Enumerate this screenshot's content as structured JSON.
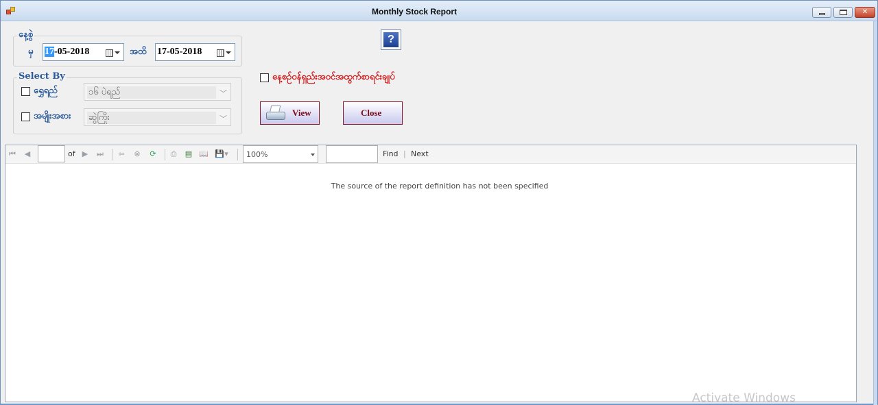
{
  "window": {
    "title": "Monthly Stock Report"
  },
  "date_group": {
    "legend": "နေ့စွဲ",
    "from_label": "မှ",
    "from_value_selected": "17",
    "from_value_rest": "-05-2018",
    "to_label": "အထိ",
    "to_value": "17-05-2018"
  },
  "select_by": {
    "legend": "Select By",
    "row1_label": "ရွှေရည်",
    "row1_value": "၁၆ ပဲရည်",
    "row2_label": "အမျိုးအစား",
    "row2_value": "ဆွဲကြိုး"
  },
  "options": {
    "daily_checkbox_label": "နေ့စဉ်ဝန်ရှည်းအဝင်အထွက်စာရင်းချုပ်"
  },
  "buttons": {
    "help_label": "?",
    "view_label": "View",
    "close_label": "Close"
  },
  "report_toolbar": {
    "of_label": "of",
    "zoom_value": "100%",
    "find_label": "Find",
    "separator": "|",
    "next_label": "Next"
  },
  "report": {
    "message": "The source of the report definition has not been specified"
  },
  "watermark": {
    "text": "Activate Windows"
  }
}
